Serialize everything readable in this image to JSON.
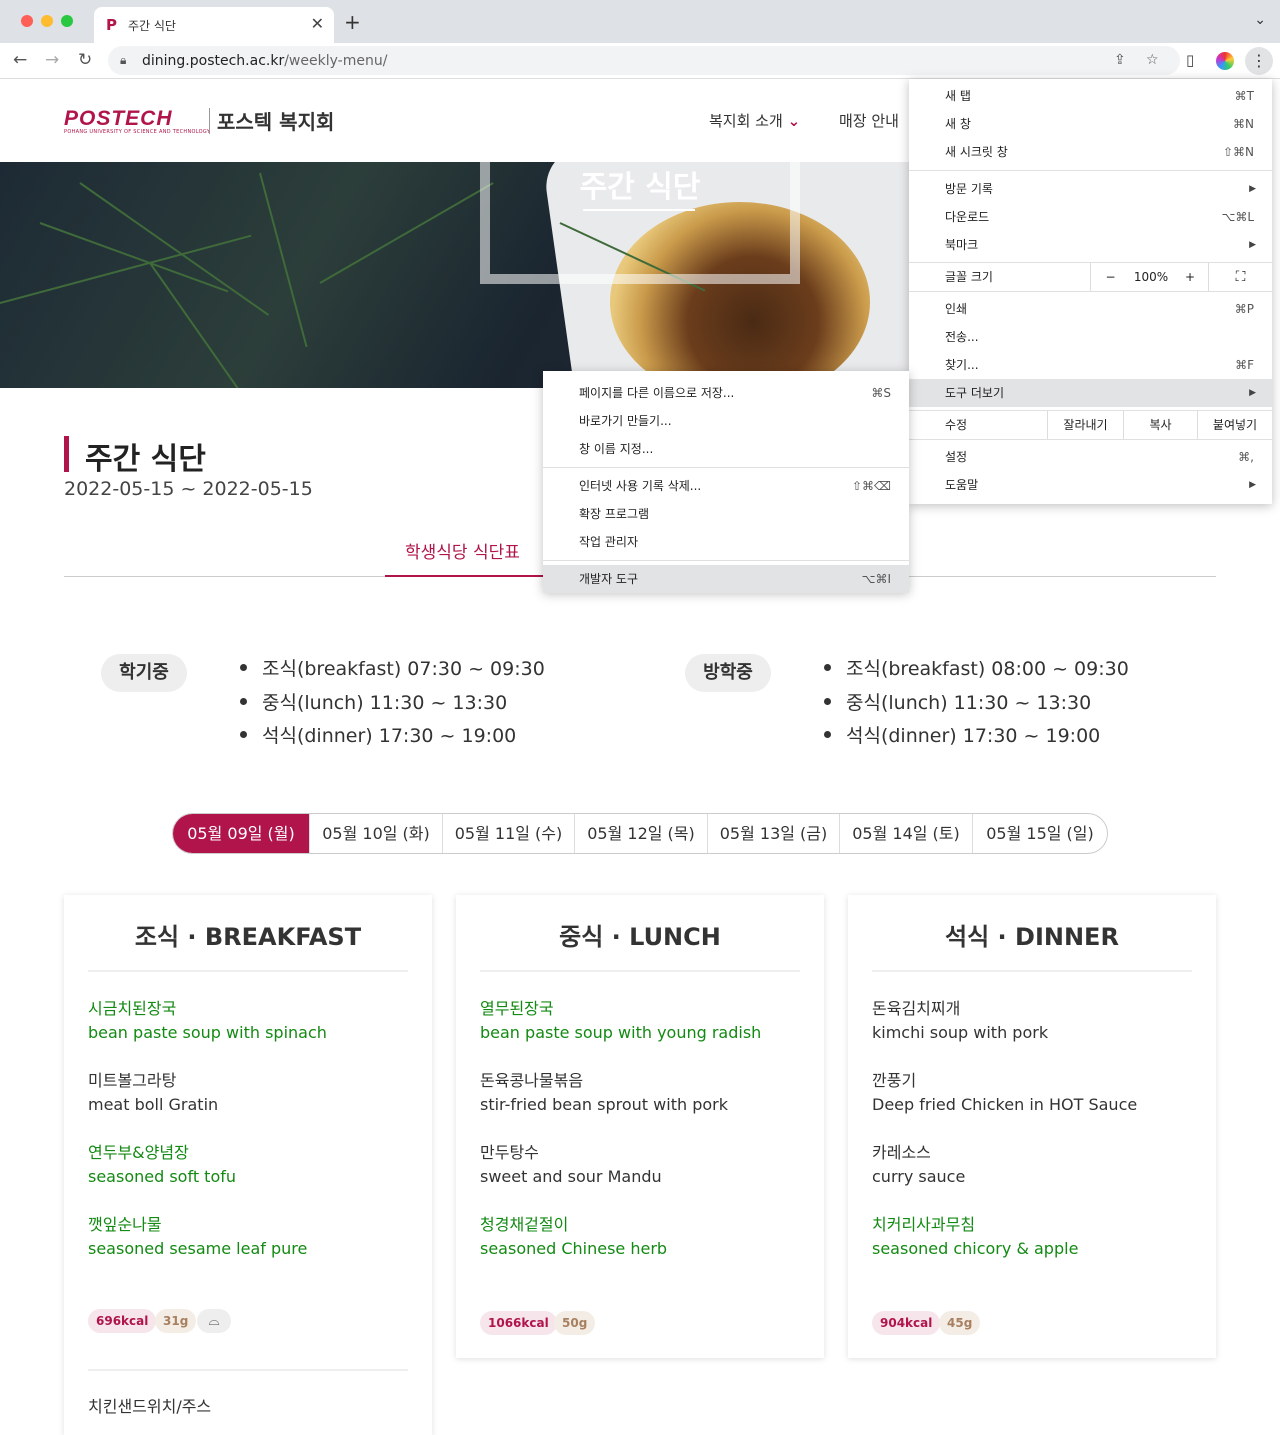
{
  "browser": {
    "tab_title": "주간 식단",
    "url_host": "dining.postech.ac.kr",
    "url_path": "/weekly-menu/"
  },
  "header": {
    "logo_word": "POSTECH",
    "logo_sub": "POHANG UNIVERSITY OF SCIENCE AND TECHNOLOGY",
    "logo_kr": "포스텍 복지회",
    "nav": [
      "복지회 소개",
      "매장 안내"
    ]
  },
  "hero": {
    "title": "주간 식단"
  },
  "page": {
    "title": "주간 식단",
    "range": "2022-05-15 ~ 2022-05-15",
    "active_tab": "학생식당 식단표"
  },
  "schedule": {
    "semester": {
      "label": "학기중",
      "hours": [
        "조식(breakfast) 07:30 ~ 09:30",
        "중식(lunch) 11:30 ~ 13:30",
        "석식(dinner) 17:30 ~ 19:00"
      ]
    },
    "vacation": {
      "label": "방학중",
      "hours": [
        "조식(breakfast) 08:00 ~ 09:30",
        "중식(lunch) 11:30 ~ 13:30",
        "석식(dinner) 17:30 ~ 19:00"
      ]
    }
  },
  "days": [
    "05월 09일 (월)",
    "05월 10일 (화)",
    "05월 11일 (수)",
    "05월 12일 (목)",
    "05월 13일 (금)",
    "05월 14일 (토)",
    "05월 15일 (일)"
  ],
  "colors": {
    "brand": "#b0144a",
    "green": "#138a13"
  },
  "meals": [
    {
      "title": "조식 · BREAKFAST",
      "items": [
        {
          "kr": "시금치된장국",
          "en": "bean paste soup with spinach",
          "green": true
        },
        {
          "kr": "미트볼그라탕",
          "en": "meat boll Gratin",
          "green": false
        },
        {
          "kr": "연두부&양념장",
          "en": "seasoned soft tofu",
          "green": true
        },
        {
          "kr": "깻잎순나물",
          "en": "seasoned sesame leaf pure",
          "green": true
        }
      ],
      "kcal": "696kcal",
      "grams": "31g",
      "extra_icon": "bowl-icon",
      "next_item": "치킨샌드위치/주스"
    },
    {
      "title": "중식 · LUNCH",
      "items": [
        {
          "kr": "열무된장국",
          "en": "bean paste soup with young radish",
          "green": true
        },
        {
          "kr": "돈육콩나물볶음",
          "en": "stir-fried bean sprout with pork",
          "green": false
        },
        {
          "kr": "만두탕수",
          "en": "sweet and sour Mandu",
          "green": false
        },
        {
          "kr": "청경채겉절이",
          "en": "seasoned Chinese herb",
          "green": true
        }
      ],
      "kcal": "1066kcal",
      "grams": "50g"
    },
    {
      "title": "석식 · DINNER",
      "items": [
        {
          "kr": "돈육김치찌개",
          "en": "kimchi soup with pork",
          "green": false
        },
        {
          "kr": "깐풍기",
          "en": "Deep fried Chicken in HOT Sauce",
          "green": false
        },
        {
          "kr": "카레소스",
          "en": "curry sauce",
          "green": false
        },
        {
          "kr": "치커리사과무침",
          "en": "seasoned chicory & apple",
          "green": true
        }
      ],
      "kcal": "904kcal",
      "grams": "45g"
    }
  ],
  "chrome_menu": {
    "new_tab": "새 탭",
    "new_tab_sc": "⌘T",
    "new_window": "새 창",
    "new_window_sc": "⌘N",
    "incognito": "새 시크릿 창",
    "incognito_sc": "⇧⌘N",
    "history": "방문 기록",
    "downloads": "다운로드",
    "downloads_sc": "⌥⌘L",
    "bookmarks": "북마크",
    "zoom_label": "글꼴 크기",
    "zoom_minus": "−",
    "zoom_value": "100%",
    "zoom_plus": "+",
    "print": "인쇄",
    "print_sc": "⌘P",
    "cast": "전송...",
    "find": "찾기...",
    "find_sc": "⌘F",
    "more_tools": "도구 더보기",
    "edit": "수정",
    "cut": "잘라내기",
    "copy": "복사",
    "paste": "붙여넣기",
    "settings": "설정",
    "settings_sc": "⌘,",
    "help": "도움말"
  },
  "sub_menu": {
    "save_as": "페이지를 다른 이름으로 저장...",
    "save_as_sc": "⌘S",
    "shortcut": "바로가기 만들기...",
    "name_window": "창 이름 지정...",
    "clear_data": "인터넷 사용 기록 삭제...",
    "clear_data_sc": "⇧⌘⌫",
    "extensions": "확장 프로그램",
    "task_manager": "작업 관리자",
    "dev_tools": "개발자 도구",
    "dev_tools_sc": "⌥⌘I"
  }
}
